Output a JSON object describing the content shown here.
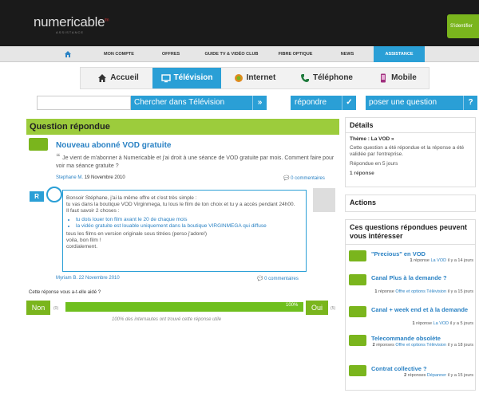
{
  "header": {
    "logo": "numericable",
    "logo_sub": "ASSISTANCE",
    "login_label": "S'identifier"
  },
  "topnav": {
    "items": [
      "MON COMPTE",
      "OFFRES",
      "GUIDE TV & VIDÉO CLUB",
      "FIBRE OPTIQUE",
      "NEWS",
      "ASSISTANCE"
    ]
  },
  "tabs": [
    "Accueil",
    "Télévision",
    "Internet",
    "Téléphone",
    "Mobile"
  ],
  "search": {
    "placeholder": "",
    "button": "Chercher dans Télévision",
    "answer_button": "répondre",
    "ask_button": "poser une question"
  },
  "question": {
    "section_title": "Question répondue",
    "title": "Nouveau abonné VOD gratuite",
    "body": "Je vient de m'abonner à Numericable et j'ai droit à une séance de VOD gratuite par mois. Comment faire pour voir ma séance gratuite ?",
    "author": "Stephane M.",
    "date": "19 Novembre 2010",
    "comments": "0 commentaires"
  },
  "answer": {
    "badge": "R",
    "greeting": "Bonsoir Stéphane, j'ai la même offre et c'est très simple :",
    "line1": "tu vas dans la boutique VOD Virginmega, tu lous le film de ton choix et tu y a accès pendant 24h00.",
    "line2": "Il faut savoir 2 choses :",
    "bullet1": "tu dois louer ton film avant le 20 de chaque mois",
    "bullet2": "la vidéo gratuite est louable uniquement dans la boutique VIRGINMEGA qui diffuse",
    "line3": "tous les films en version originale sous titrées (perso j'adore!)",
    "line4": "voila, bon film !",
    "line5": "cordialement.",
    "author": "Myriam B.",
    "date": "22 Novembre 2010",
    "comments": "0 commentaires"
  },
  "rating": {
    "question": "Cette réponse vous a-t-elle aidé ?",
    "no_label": "Non",
    "no_count": "(0)",
    "yes_label": "Oui",
    "yes_count": "(5)",
    "percent_label": "100%",
    "percent_value": 100,
    "summary": "100% des internautes ont trouvé cette réponse utile"
  },
  "details": {
    "title": "Détails",
    "theme": "Thème : La VOD",
    "text": "Cette question a été répondue et la réponse a été validée par l'entreprise.",
    "answered": "Répondue en 5 jours",
    "responses": "1 réponse"
  },
  "actions": {
    "title": "Actions"
  },
  "related": {
    "title": "Ces questions répondues peuvent vous intéresser",
    "items": [
      {
        "title": "\"Precious\" en VOD",
        "count": "1",
        "label": "réponse",
        "cat": "La VOD",
        "age": "il y a 14 jours"
      },
      {
        "title": "Canal Plus à la demande ?",
        "count": "1",
        "label": "réponse",
        "cat": "Offre et options Télévision",
        "age": "il y a 15 jours"
      },
      {
        "title": "Canal + week end et à la demande",
        "count": "1",
        "label": "réponse",
        "cat": "La VOD",
        "age": "il y a 5 jours"
      },
      {
        "title": "Telecommande obsolète",
        "count": "2",
        "label": "réponses",
        "cat": "Offre et options Télévision",
        "age": "il y a 18 jours"
      },
      {
        "title": "Contrat collective ?",
        "count": "2",
        "label": "réponses",
        "cat": "Dépanner",
        "age": "il y a 15 jours"
      }
    ]
  },
  "colors": {
    "accent_blue": "#2a9fd6",
    "accent_green": "#7ab51d",
    "header_black": "#1a1a1a"
  }
}
